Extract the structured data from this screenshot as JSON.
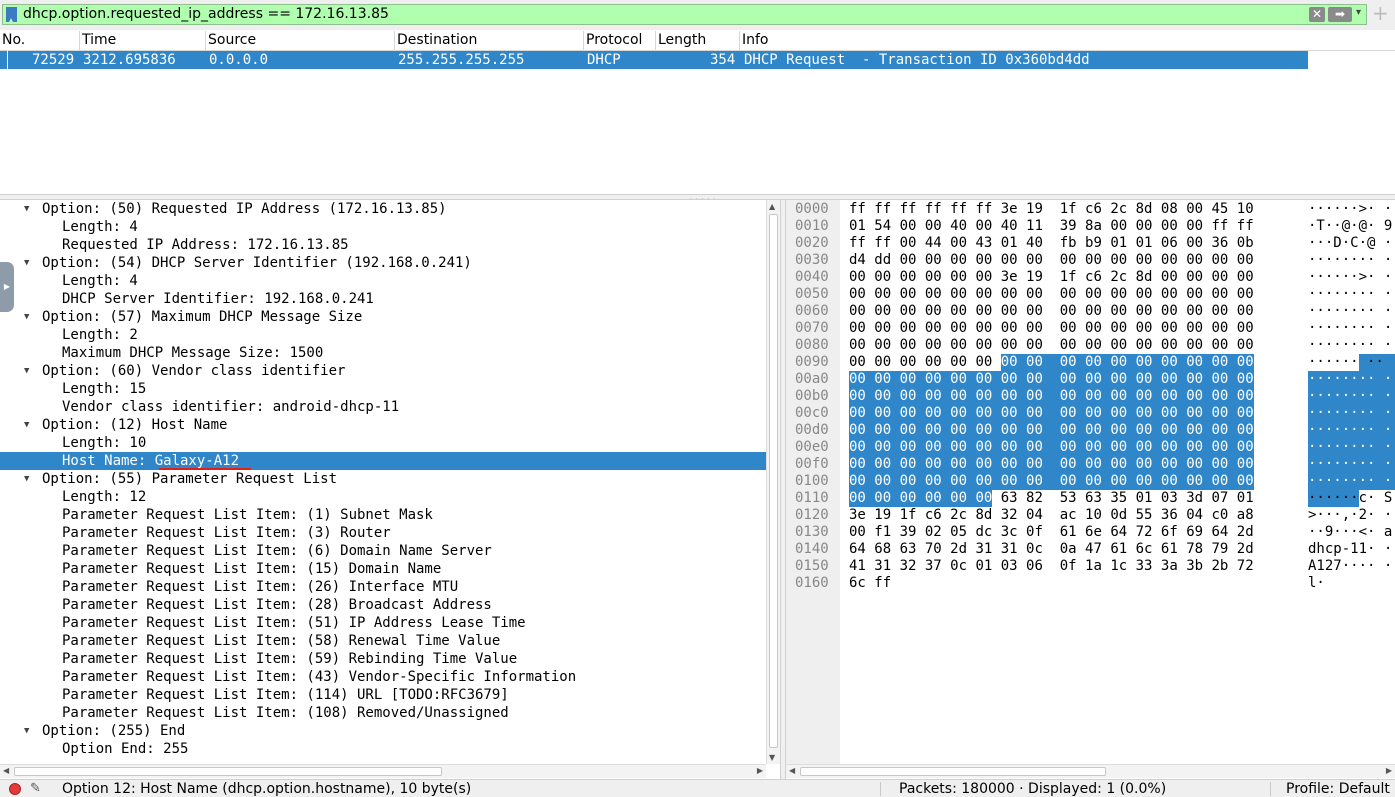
{
  "filter": {
    "expression": "dhcp.option.requested_ip_address == 172.16.13.85",
    "clear_glyph": "✕",
    "apply_glyph": "➡",
    "dropdown_glyph": "▾",
    "add_glyph": "+"
  },
  "packet_list": {
    "columns": [
      "No.",
      "Time",
      "Source",
      "Destination",
      "Protocol",
      "Length",
      "Info"
    ],
    "rows": [
      {
        "no": "72529",
        "time": "3212.695836",
        "source": "0.0.0.0",
        "destination": "255.255.255.255",
        "protocol": "DHCP",
        "length": "354",
        "info": "DHCP Request  - Transaction ID 0x360bd4dd",
        "selected": true
      }
    ]
  },
  "details": {
    "lines": [
      {
        "level": 0,
        "expanded": true,
        "text": "Option: (50) Requested IP Address (172.16.13.85)"
      },
      {
        "level": 1,
        "text": "Length: 4"
      },
      {
        "level": 1,
        "text": "Requested IP Address: 172.16.13.85"
      },
      {
        "level": 0,
        "expanded": true,
        "text": "Option: (54) DHCP Server Identifier (192.168.0.241)"
      },
      {
        "level": 1,
        "text": "Length: 4"
      },
      {
        "level": 1,
        "text": "DHCP Server Identifier: 192.168.0.241"
      },
      {
        "level": 0,
        "expanded": true,
        "text": "Option: (57) Maximum DHCP Message Size"
      },
      {
        "level": 1,
        "text": "Length: 2"
      },
      {
        "level": 1,
        "text": "Maximum DHCP Message Size: 1500"
      },
      {
        "level": 0,
        "expanded": true,
        "text": "Option: (60) Vendor class identifier"
      },
      {
        "level": 1,
        "text": "Length: 15"
      },
      {
        "level": 1,
        "text": "Vendor class identifier: android-dhcp-11"
      },
      {
        "level": 0,
        "expanded": true,
        "text": "Option: (12) Host Name"
      },
      {
        "level": 1,
        "text": "Length: 10"
      },
      {
        "level": 1,
        "text": "Host Name: Galaxy-A12",
        "selected": true
      },
      {
        "level": 0,
        "expanded": true,
        "text": "Option: (55) Parameter Request List"
      },
      {
        "level": 1,
        "text": "Length: 12"
      },
      {
        "level": 1,
        "text": "Parameter Request List Item: (1) Subnet Mask"
      },
      {
        "level": 1,
        "text": "Parameter Request List Item: (3) Router"
      },
      {
        "level": 1,
        "text": "Parameter Request List Item: (6) Domain Name Server"
      },
      {
        "level": 1,
        "text": "Parameter Request List Item: (15) Domain Name"
      },
      {
        "level": 1,
        "text": "Parameter Request List Item: (26) Interface MTU"
      },
      {
        "level": 1,
        "text": "Parameter Request List Item: (28) Broadcast Address"
      },
      {
        "level": 1,
        "text": "Parameter Request List Item: (51) IP Address Lease Time"
      },
      {
        "level": 1,
        "text": "Parameter Request List Item: (58) Renewal Time Value"
      },
      {
        "level": 1,
        "text": "Parameter Request List Item: (59) Rebinding Time Value"
      },
      {
        "level": 1,
        "text": "Parameter Request List Item: (43) Vendor-Specific Information"
      },
      {
        "level": 1,
        "text": "Parameter Request List Item: (114) URL [TODO:RFC3679]"
      },
      {
        "level": 1,
        "text": "Parameter Request List Item: (108) Removed/Unassigned"
      },
      {
        "level": 0,
        "expanded": true,
        "text": "Option: (255) End"
      },
      {
        "level": 1,
        "text": "Option End: 255"
      }
    ]
  },
  "bytes": {
    "rows": [
      {
        "offset": "0000",
        "hex": [
          "ff",
          "ff",
          "ff",
          "ff",
          "ff",
          "ff",
          "3e",
          "19",
          "1f",
          "c6",
          "2c",
          "8d",
          "08",
          "00",
          "45",
          "10"
        ],
        "ascii": "······>· ·"
      },
      {
        "offset": "0010",
        "hex": [
          "01",
          "54",
          "00",
          "00",
          "40",
          "00",
          "40",
          "11",
          "39",
          "8a",
          "00",
          "00",
          "00",
          "00",
          "ff",
          "ff"
        ],
        "ascii": "·T··@·@· 9"
      },
      {
        "offset": "0020",
        "hex": [
          "ff",
          "ff",
          "00",
          "44",
          "00",
          "43",
          "01",
          "40",
          "fb",
          "b9",
          "01",
          "01",
          "06",
          "00",
          "36",
          "0b"
        ],
        "ascii": "···D·C·@ ·"
      },
      {
        "offset": "0030",
        "hex": [
          "d4",
          "dd",
          "00",
          "00",
          "00",
          "00",
          "00",
          "00",
          "00",
          "00",
          "00",
          "00",
          "00",
          "00",
          "00",
          "00"
        ],
        "ascii": "········ ·"
      },
      {
        "offset": "0040",
        "hex": [
          "00",
          "00",
          "00",
          "00",
          "00",
          "00",
          "3e",
          "19",
          "1f",
          "c6",
          "2c",
          "8d",
          "00",
          "00",
          "00",
          "00"
        ],
        "ascii": "······>· ·"
      },
      {
        "offset": "0050",
        "hex": [
          "00",
          "00",
          "00",
          "00",
          "00",
          "00",
          "00",
          "00",
          "00",
          "00",
          "00",
          "00",
          "00",
          "00",
          "00",
          "00"
        ],
        "ascii": "········ ·"
      },
      {
        "offset": "0060",
        "hex": [
          "00",
          "00",
          "00",
          "00",
          "00",
          "00",
          "00",
          "00",
          "00",
          "00",
          "00",
          "00",
          "00",
          "00",
          "00",
          "00"
        ],
        "ascii": "········ ·"
      },
      {
        "offset": "0070",
        "hex": [
          "00",
          "00",
          "00",
          "00",
          "00",
          "00",
          "00",
          "00",
          "00",
          "00",
          "00",
          "00",
          "00",
          "00",
          "00",
          "00"
        ],
        "ascii": "········ ·"
      },
      {
        "offset": "0080",
        "hex": [
          "00",
          "00",
          "00",
          "00",
          "00",
          "00",
          "00",
          "00",
          "00",
          "00",
          "00",
          "00",
          "00",
          "00",
          "00",
          "00"
        ],
        "ascii": "········ ·"
      },
      {
        "offset": "0090",
        "hex": [
          "00",
          "00",
          "00",
          "00",
          "00",
          "00",
          "00",
          "00",
          "00",
          "00",
          "00",
          "00",
          "00",
          "00",
          "00",
          "00"
        ],
        "ascii": "······ ··",
        "hl_from": 6
      },
      {
        "offset": "00a0",
        "hex": [
          "00",
          "00",
          "00",
          "00",
          "00",
          "00",
          "00",
          "00",
          "00",
          "00",
          "00",
          "00",
          "00",
          "00",
          "00",
          "00"
        ],
        "ascii": "········ ·",
        "hl_from": 0
      },
      {
        "offset": "00b0",
        "hex": [
          "00",
          "00",
          "00",
          "00",
          "00",
          "00",
          "00",
          "00",
          "00",
          "00",
          "00",
          "00",
          "00",
          "00",
          "00",
          "00"
        ],
        "ascii": "········ ·",
        "hl_from": 0
      },
      {
        "offset": "00c0",
        "hex": [
          "00",
          "00",
          "00",
          "00",
          "00",
          "00",
          "00",
          "00",
          "00",
          "00",
          "00",
          "00",
          "00",
          "00",
          "00",
          "00"
        ],
        "ascii": "········ ·",
        "hl_from": 0
      },
      {
        "offset": "00d0",
        "hex": [
          "00",
          "00",
          "00",
          "00",
          "00",
          "00",
          "00",
          "00",
          "00",
          "00",
          "00",
          "00",
          "00",
          "00",
          "00",
          "00"
        ],
        "ascii": "········ ·",
        "hl_from": 0
      },
      {
        "offset": "00e0",
        "hex": [
          "00",
          "00",
          "00",
          "00",
          "00",
          "00",
          "00",
          "00",
          "00",
          "00",
          "00",
          "00",
          "00",
          "00",
          "00",
          "00"
        ],
        "ascii": "········ ·",
        "hl_from": 0
      },
      {
        "offset": "00f0",
        "hex": [
          "00",
          "00",
          "00",
          "00",
          "00",
          "00",
          "00",
          "00",
          "00",
          "00",
          "00",
          "00",
          "00",
          "00",
          "00",
          "00"
        ],
        "ascii": "········ ·",
        "hl_from": 0
      },
      {
        "offset": "0100",
        "hex": [
          "00",
          "00",
          "00",
          "00",
          "00",
          "00",
          "00",
          "00",
          "00",
          "00",
          "00",
          "00",
          "00",
          "00",
          "00",
          "00"
        ],
        "ascii": "········ ·",
        "hl_from": 0
      },
      {
        "offset": "0110",
        "hex": [
          "00",
          "00",
          "00",
          "00",
          "00",
          "00",
          "63",
          "82",
          "53",
          "63",
          "35",
          "01",
          "03",
          "3d",
          "07",
          "01"
        ],
        "ascii": "······c· S",
        "hl_to": 6
      },
      {
        "offset": "0120",
        "hex": [
          "3e",
          "19",
          "1f",
          "c6",
          "2c",
          "8d",
          "32",
          "04",
          "ac",
          "10",
          "0d",
          "55",
          "36",
          "04",
          "c0",
          "a8"
        ],
        "ascii": ">···,·2· ·"
      },
      {
        "offset": "0130",
        "hex": [
          "00",
          "f1",
          "39",
          "02",
          "05",
          "dc",
          "3c",
          "0f",
          "61",
          "6e",
          "64",
          "72",
          "6f",
          "69",
          "64",
          "2d"
        ],
        "ascii": "··9···<· a"
      },
      {
        "offset": "0140",
        "hex": [
          "64",
          "68",
          "63",
          "70",
          "2d",
          "31",
          "31",
          "0c",
          "0a",
          "47",
          "61",
          "6c",
          "61",
          "78",
          "79",
          "2d"
        ],
        "ascii": "dhcp-11· ·"
      },
      {
        "offset": "0150",
        "hex": [
          "41",
          "31",
          "32",
          "37",
          "0c",
          "01",
          "03",
          "06",
          "0f",
          "1a",
          "1c",
          "33",
          "3a",
          "3b",
          "2b",
          "72"
        ],
        "ascii": "A127···· ·"
      },
      {
        "offset": "0160",
        "hex": [
          "6c",
          "ff"
        ],
        "ascii": "l·"
      }
    ]
  },
  "statusbar": {
    "field_info": "Option 12: Host Name (dhcp.option.hostname), 10 byte(s)",
    "packets": "Packets: 180000 · Displayed: 1 (0.0%)",
    "profile": "Profile: Default"
  },
  "colors": {
    "selection": "#2f86c9",
    "filter_valid": "#afffaf",
    "underline": "#e0201a"
  }
}
